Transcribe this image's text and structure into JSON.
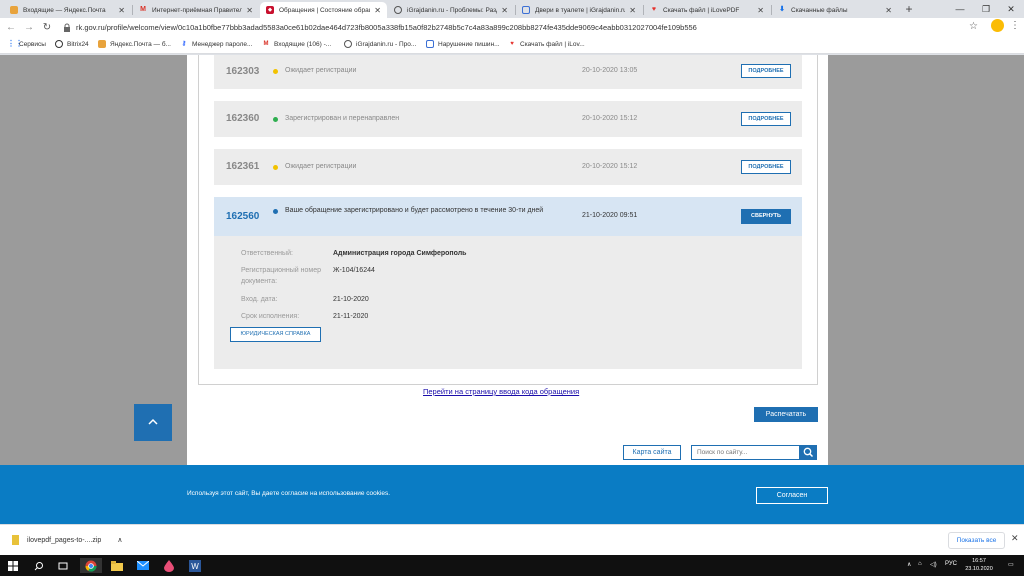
{
  "browser": {
    "tabs": [
      {
        "title": "Входящие — Яндекс.Почта",
        "icon": "mail-icon"
      },
      {
        "title": "Интернет-приёмная Правительс",
        "icon": "gmail-icon"
      },
      {
        "title": "Обращения | Состояние обращ",
        "icon": "shield-icon",
        "active": true
      },
      {
        "title": "iGrajdanin.ru - Проблемы: Разд",
        "icon": "globe-icon"
      },
      {
        "title": "Двери в туалете | iGrajdanin.ru",
        "icon": "doc-icon"
      },
      {
        "title": "Скачать файл | iLovePDF",
        "icon": "heart-icon"
      },
      {
        "title": "Скачанные файлы",
        "icon": "download-icon"
      }
    ],
    "url": "rk.gov.ru/profile/welcome/view/0c10a1b0fbe77bbb3adad5583a0ce61b02dae464d723fb8005a338fb15a0f82b2748b5c7c4a83a899c208bb8274fe435dde9069c4eabb0312027004fe109b556",
    "bookmarks": [
      {
        "label": "Сервисы",
        "icon": "apps-icon"
      },
      {
        "label": "Bitrix24",
        "icon": "bitrix-icon"
      },
      {
        "label": "Яндекс.Почта — б...",
        "icon": "mail-icon"
      },
      {
        "label": "Менеджер пароле...",
        "icon": "key-icon"
      },
      {
        "label": "Входящие (106) -...",
        "icon": "gmail-icon"
      },
      {
        "label": "iGrajdanin.ru - Про...",
        "icon": "globe-icon"
      },
      {
        "label": "Нарушение пишин...",
        "icon": "doc-icon"
      },
      {
        "label": "Скачать файл | iLov...",
        "icon": "heart-icon"
      }
    ]
  },
  "appeals": [
    {
      "number": "162303",
      "status": "Ожидает регистрации",
      "status_color": "#f2c200",
      "date": "20-10-2020 13:05",
      "button": "ПОДРОБНЕЕ"
    },
    {
      "number": "162360",
      "status": "Зарегистрирован и перенаправлен",
      "status_color": "#2eae4f",
      "date": "20-10-2020 15:12",
      "button": "ПОДРОБНЕЕ"
    },
    {
      "number": "162361",
      "status": "Ожидает регистрации",
      "status_color": "#f2c200",
      "date": "20-10-2020 15:12",
      "button": "ПОДРОБНЕЕ"
    }
  ],
  "open_appeal": {
    "number": "162560",
    "status": "Ваше обращение зарегистрировано и будет рассмотрено в течение 30-ти дней",
    "status_color": "#1f6fb2",
    "date": "21-10-2020 09:51",
    "button": "СВЕРНУТЬ",
    "details": {
      "responsible_label": "Ответственный:",
      "responsible_value": "Администрация города Симферополь",
      "regnum_label": "Регистрационный номер документа:",
      "regnum_value": "Ж-104/16244",
      "in_date_label": "Вход. дата:",
      "in_date_value": "21-10-2020",
      "due_label": "Срок исполнения:",
      "due_value": "21-11-2020",
      "legal_button": "ЮРИДИЧЕСКАЯ СПРАВКА"
    }
  },
  "page": {
    "goto_link": "Перейти на страницу ввода кода обращения",
    "print_button": "Распечатать",
    "sitemap_button": "Карта сайта",
    "search_placeholder": "Поиск по сайту...",
    "cookie_text": "Используя этот сайт, Вы даете согласие на использование cookies.",
    "cookie_button": "Согласен"
  },
  "downloads": {
    "file": "ilovepdf_pages-to-....zip",
    "show_all": "Показать все"
  },
  "taskbar": {
    "lang": "РУС",
    "time": "16:57",
    "date": "23.10.2020"
  }
}
